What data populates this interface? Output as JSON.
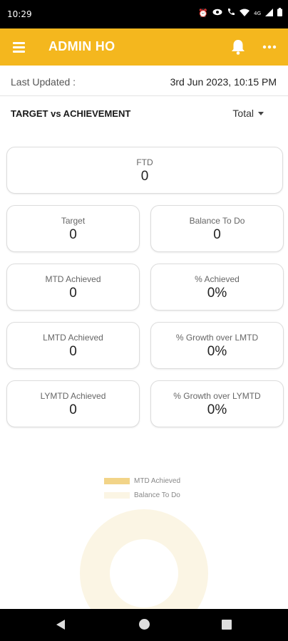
{
  "status_bar": {
    "time": "10:29",
    "icons": [
      "alarm-icon",
      "eye-icon",
      "call-icon",
      "wifi-icon",
      "signal-icon",
      "battery-icon"
    ],
    "network": "4G"
  },
  "app_bar": {
    "title": "ADMIN HO",
    "background": "#F4B71E",
    "icons": [
      "menu-icon",
      "bell-icon",
      "more-icon"
    ]
  },
  "last_updated": {
    "label": "Last Updated :",
    "value": "3rd Jun 2023, 10:15 PM"
  },
  "section": {
    "title": "TARGET vs ACHIEVEMENT",
    "filter": "Total"
  },
  "cards": {
    "ftd": {
      "label": "FTD",
      "value": "0"
    },
    "target": {
      "label": "Target",
      "value": "0"
    },
    "balance": {
      "label": "Balance To Do",
      "value": "0"
    },
    "mtd": {
      "label": "MTD Achieved",
      "value": "0"
    },
    "pct_achieved": {
      "label": "% Achieved",
      "value": "0%"
    },
    "lmtd": {
      "label": "LMTD Achieved",
      "value": "0"
    },
    "growth_lmtd": {
      "label": "% Growth over LMTD",
      "value": "0%"
    },
    "lymtd": {
      "label": "LYMTD Achieved",
      "value": "0"
    },
    "growth_lymtd": {
      "label": "% Growth over LYMTD",
      "value": "0%"
    }
  },
  "chart_data": {
    "type": "pie",
    "series": [
      {
        "name": "MTD Achieved",
        "value": 0,
        "color": "#F2D488"
      },
      {
        "name": "Balance To Do",
        "value": 0,
        "color": "#FBF5E4"
      }
    ],
    "legend_position": "top"
  }
}
